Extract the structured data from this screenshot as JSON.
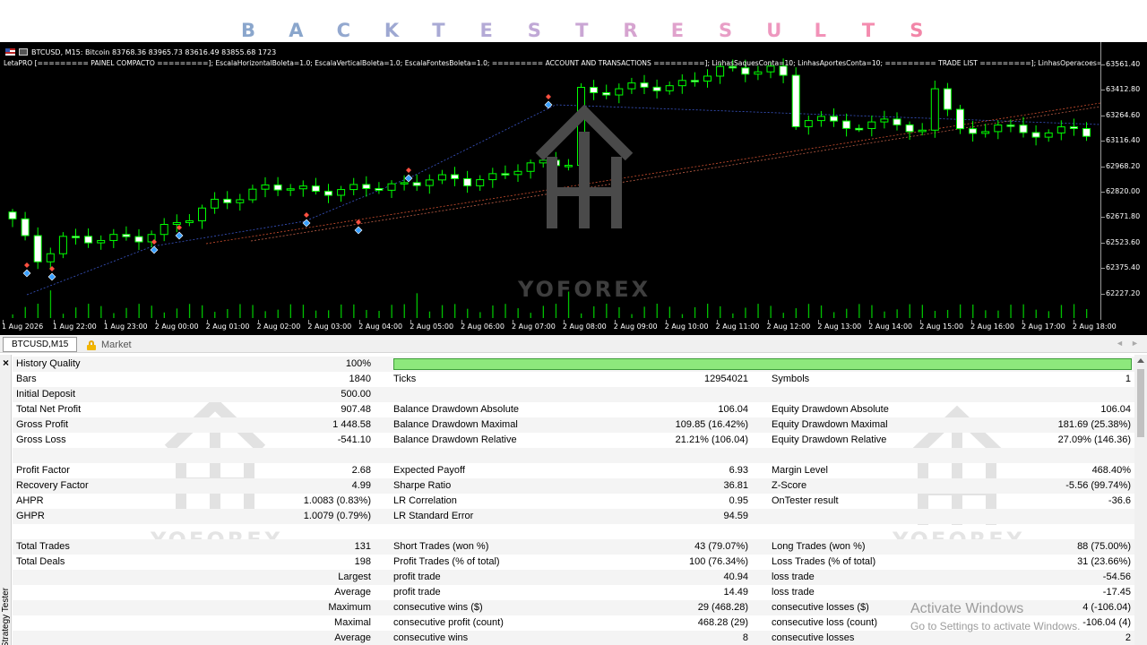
{
  "banner": {
    "letters": [
      {
        "ch": "B",
        "color": "#8aa6cc"
      },
      {
        "ch": "A",
        "color": "#8aa6cc"
      },
      {
        "ch": "C",
        "color": "#93a8cf"
      },
      {
        "ch": "K",
        "color": "#9ea8d2"
      },
      {
        "ch": "T",
        "color": "#a9aad5"
      },
      {
        "ch": "E",
        "color": "#b4aad6"
      },
      {
        "ch": "S",
        "color": "#c0a8d6"
      },
      {
        "ch": "T",
        "color": "#caa6d4"
      },
      {
        "ch": "R",
        "color": "#d6a4d0"
      },
      {
        "ch": "E",
        "color": "#e0a2cc"
      },
      {
        "ch": "S",
        "color": "#e89ec6"
      },
      {
        "ch": "U",
        "color": "#ee98bf"
      },
      {
        "ch": "L",
        "color": "#f292b8"
      },
      {
        "ch": "T",
        "color": "#f48caf"
      },
      {
        "ch": "S",
        "color": "#f286a8"
      }
    ]
  },
  "chart": {
    "symbol_line": "BTCUSD, M15:  Bitcoin  83768.36 83965.73 83616.49 83855.68  1723",
    "panel_line": "LetaPRO [========= PAINEL COMPACTO =========]; EscalaHorizontalBoleta=1.0; EscalaVerticalBoleta=1.0; EscalaFontesBoleta=1.0; ========= ACCOUNT AND TRANSACTIONS =========]; LinhasSaquesConta=10; LinhasAportesConta=10; ========= TRADE LIST =========]; LinhasOperacoes=10; L",
    "price_labels": [
      "63561.40",
      "63412.80",
      "63264.60",
      "63116.40",
      "62968.20",
      "62820.00",
      "62671.80",
      "62523.60",
      "62375.40",
      "62227.20"
    ],
    "time_labels": [
      "1 Aug 2026",
      "1 Aug 22:00",
      "1 Aug 23:00",
      "2 Aug 00:00",
      "2 Aug 01:00",
      "2 Aug 02:00",
      "2 Aug 03:00",
      "2 Aug 04:00",
      "2 Aug 05:00",
      "2 Aug 06:00",
      "2 Aug 07:00",
      "2 Aug 08:00",
      "2 Aug 09:00",
      "2 Aug 10:00",
      "2 Aug 11:00",
      "2 Aug 12:00",
      "2 Aug 13:00",
      "2 Aug 14:00",
      "2 Aug 15:00",
      "2 Aug 16:00",
      "2 Aug 17:00",
      "2 Aug 18:00"
    ],
    "colors": {
      "up_candle": "#00ff00",
      "down_candle": "#00ff00",
      "body_bull": "#000000",
      "body_bear": "#ffffff",
      "volume": "#00c000"
    }
  },
  "watermark": {
    "text": "YOFOREX"
  },
  "tabs": {
    "active": "BTCUSD,M15",
    "market": "Market"
  },
  "side_label": "Strategy Tester",
  "results": {
    "history_quality_label": "History Quality",
    "history_quality_value": "100%",
    "history_quality_fraction": 1.0,
    "rows": [
      [
        "Bars",
        "1840",
        "Ticks",
        "12954021",
        "Symbols",
        "1"
      ],
      [
        "Initial Deposit",
        "500.00",
        "",
        "",
        "",
        ""
      ],
      [
        "Total Net Profit",
        "907.48",
        "Balance Drawdown Absolute",
        "106.04",
        "Equity Drawdown Absolute",
        "106.04"
      ],
      [
        "Gross Profit",
        "1 448.58",
        "Balance Drawdown Maximal",
        "109.85 (16.42%)",
        "Equity Drawdown Maximal",
        "181.69 (25.38%)"
      ],
      [
        "Gross Loss",
        "-541.10",
        "Balance Drawdown Relative",
        "21.21% (106.04)",
        "Equity Drawdown Relative",
        "27.09% (146.36)"
      ],
      [
        "",
        "",
        "",
        "",
        "",
        ""
      ],
      [
        "Profit Factor",
        "2.68",
        "Expected Payoff",
        "6.93",
        "Margin Level",
        "468.40%"
      ],
      [
        "Recovery Factor",
        "4.99",
        "Sharpe Ratio",
        "36.81",
        "Z-Score",
        "-5.56 (99.74%)"
      ],
      [
        "AHPR",
        "1.0083 (0.83%)",
        "LR Correlation",
        "0.95",
        "OnTester result",
        "-36.6"
      ],
      [
        "GHPR",
        "1.0079 (0.79%)",
        "LR Standard Error",
        "94.59",
        "",
        ""
      ],
      [
        "",
        "",
        "",
        "",
        "",
        ""
      ],
      [
        "Total Trades",
        "131",
        "Short Trades (won %)",
        "43 (79.07%)",
        "Long Trades (won %)",
        "88 (75.00%)"
      ],
      [
        "Total Deals",
        "198",
        "Profit Trades (% of total)",
        "100 (76.34%)",
        "Loss Trades (% of total)",
        "31 (23.66%)"
      ]
    ],
    "right_rows": [
      [
        "Largest",
        "profit trade",
        "40.94",
        "loss trade",
        "-54.56"
      ],
      [
        "Average",
        "profit trade",
        "14.49",
        "loss trade",
        "-17.45"
      ],
      [
        "Maximum",
        "consecutive wins ($)",
        "29 (468.28)",
        "consecutive losses ($)",
        "4 (-106.04)"
      ],
      [
        "Maximal",
        "consecutive profit (count)",
        "468.28 (29)",
        "consecutive loss (count)",
        "-106.04 (4)"
      ],
      [
        "Average",
        "consecutive wins",
        "8",
        "consecutive losses",
        "2"
      ]
    ]
  },
  "os_notice": {
    "title": "Activate Windows",
    "subtitle": "Go to Settings to activate Windows."
  }
}
